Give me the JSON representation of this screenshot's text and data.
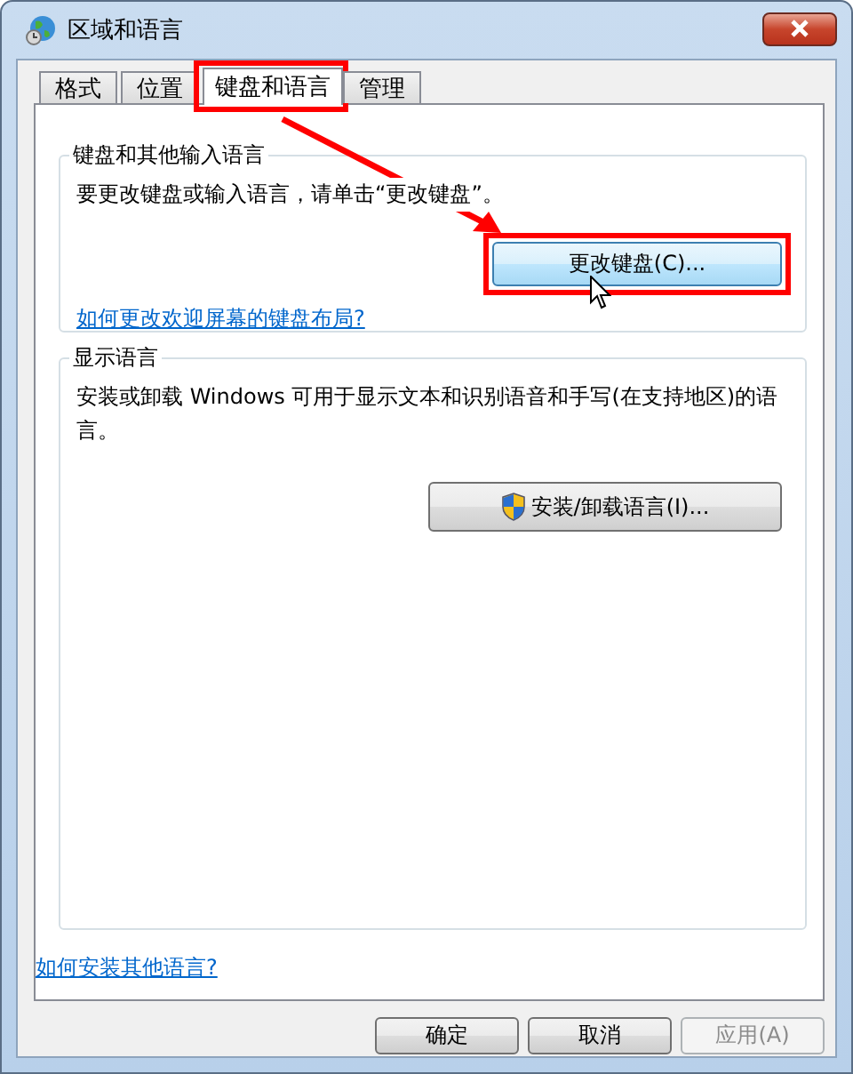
{
  "window": {
    "title": "区域和语言"
  },
  "tabs": [
    {
      "label": "格式",
      "selected": false,
      "highlighted": false
    },
    {
      "label": "位置",
      "selected": false,
      "highlighted": false
    },
    {
      "label": "键盘和语言",
      "selected": true,
      "highlighted": true
    },
    {
      "label": "管理",
      "selected": false,
      "highlighted": false
    }
  ],
  "keyboard_group": {
    "title": "键盘和其他输入语言",
    "text": "要更改键盘或输入语言，请单击“更改键盘”。",
    "button": "更改键盘(C)...",
    "button_highlighted": true,
    "link": "如何更改欢迎屏幕的键盘布局?"
  },
  "display_group": {
    "title": "显示语言",
    "text": "安装或卸载 Windows 可用于显示文本和识别语音和手写(在支持地区)的语言。",
    "button": "安装/卸载语言(I)..."
  },
  "link": "如何安装其他语言?",
  "buttons": [
    {
      "label": "确定",
      "disabled": false
    },
    {
      "label": "取消",
      "disabled": false
    },
    {
      "label": "应用(A)",
      "disabled": true
    }
  ]
}
